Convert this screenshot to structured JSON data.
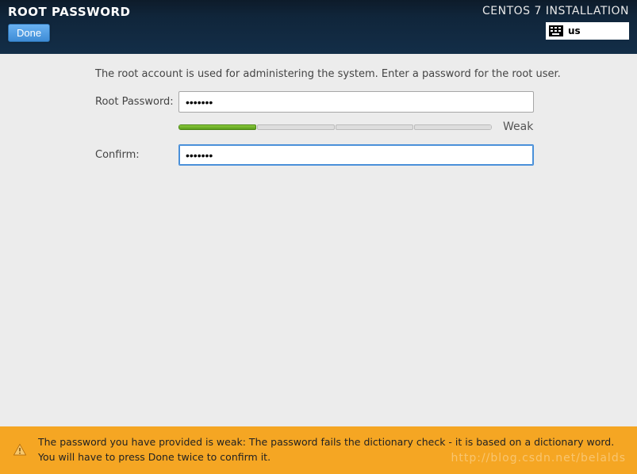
{
  "header": {
    "title": "ROOT PASSWORD",
    "done_label": "Done",
    "install_title": "CENTOS 7 INSTALLATION",
    "keyboard_layout": "us"
  },
  "form": {
    "description": "The root account is used for administering the system.   Enter a password for the root user.",
    "root_password_label": "Root Password:",
    "root_password_value": "•••••••",
    "confirm_label": "Confirm:",
    "confirm_value": "•••••••",
    "strength_label": "Weak",
    "strength_segments_filled": 1,
    "strength_segments_total": 4
  },
  "warning": {
    "text": "The password you have provided is weak: The password fails the dictionary check - it is based on a dictionary word. You will have to press Done twice to confirm it."
  },
  "watermark": "http://blog.csdn.net/belalds"
}
